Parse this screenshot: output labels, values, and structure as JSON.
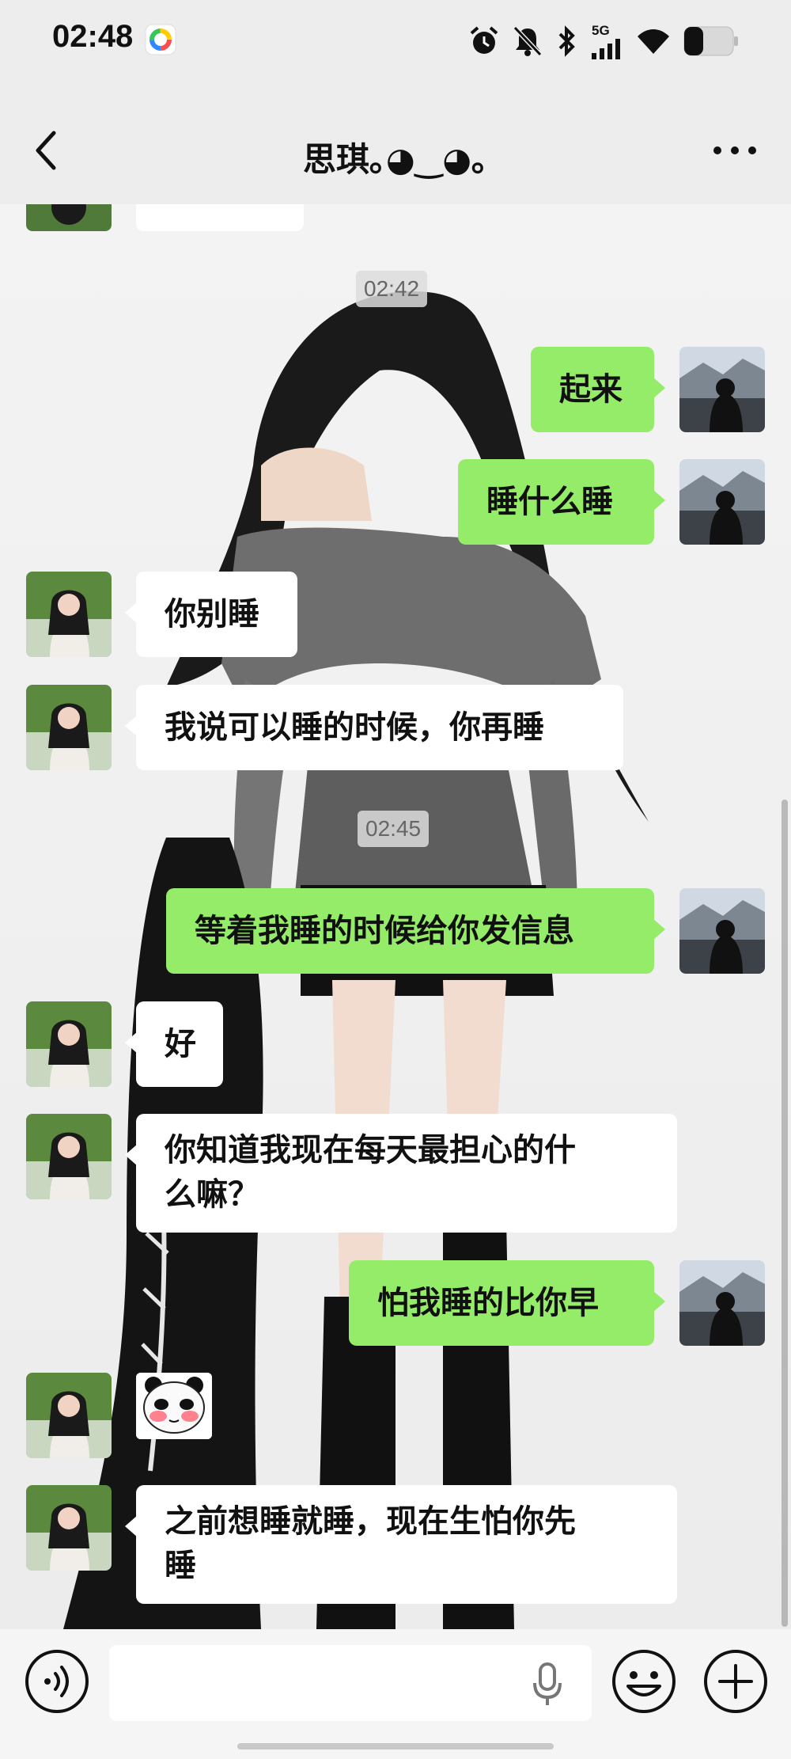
{
  "status_bar": {
    "time": "02:48",
    "network": "5G"
  },
  "header": {
    "title": "思琪｡◕‿◕｡"
  },
  "messages": [
    {
      "type": "time",
      "text": "02:42"
    },
    {
      "type": "out",
      "text": "起来"
    },
    {
      "type": "out",
      "text": "睡什么睡"
    },
    {
      "type": "in",
      "text": "你别睡"
    },
    {
      "type": "in",
      "text": "我说可以睡的时候，你再睡"
    },
    {
      "type": "time",
      "text": "02:45"
    },
    {
      "type": "out",
      "text": "等着我睡的时候给你发信息"
    },
    {
      "type": "in",
      "text": "好"
    },
    {
      "type": "in",
      "text": "你知道我现在每天最担心的什么嘛？",
      "line1": "你知道我现在每天最担心的什",
      "line2": "么嘛？"
    },
    {
      "type": "out",
      "text": "怕我睡的比你早"
    },
    {
      "type": "in_sticker",
      "icon": "panda-blush-sticker"
    },
    {
      "type": "in",
      "text": "之前想睡就睡，现在生怕你先睡",
      "line1": "之前想睡就睡，现在生怕你先",
      "line2": "睡"
    }
  ],
  "input": {
    "value": "",
    "placeholder": ""
  },
  "colors": {
    "background": "#ededed",
    "outgoing_bubble": "#95ec69",
    "incoming_bubble": "#ffffff"
  },
  "icons": [
    "back-icon",
    "more-icon",
    "alarm-icon",
    "mute-icon",
    "bluetooth-icon",
    "signal-icon",
    "wifi-icon",
    "battery-icon",
    "voice-icon",
    "mic-icon",
    "emoji-icon",
    "plus-icon"
  ]
}
